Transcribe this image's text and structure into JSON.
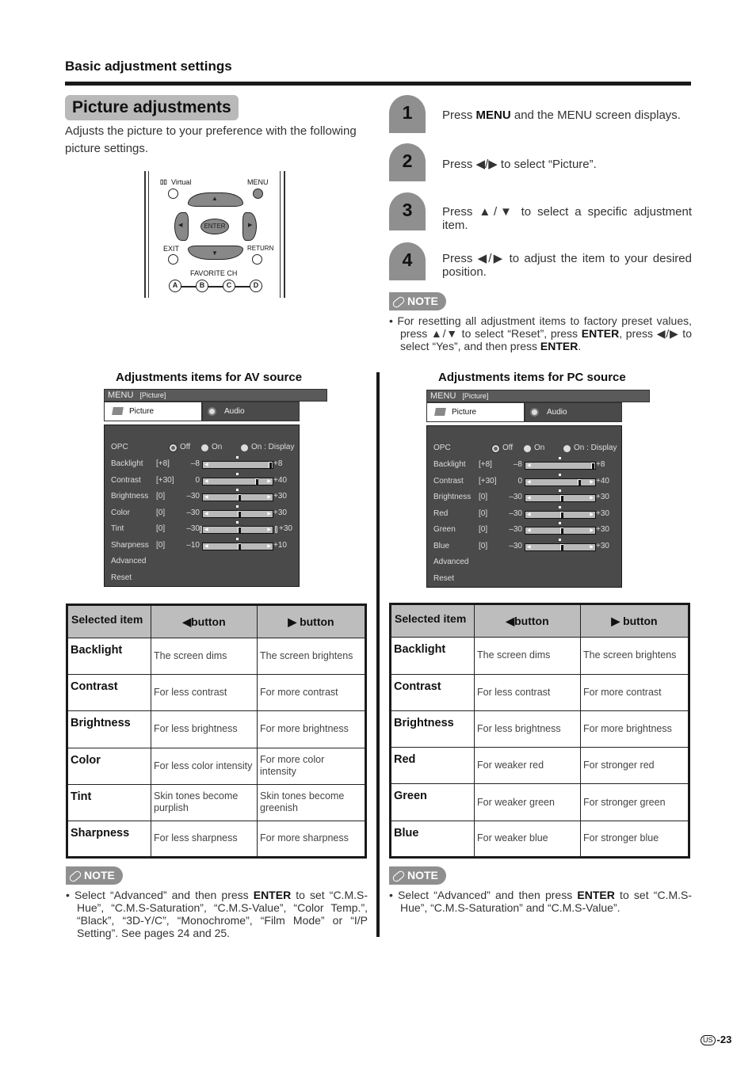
{
  "header": {
    "section_title": "Basic adjustment settings"
  },
  "intro": {
    "title": "Picture adjustments",
    "description": "Adjusts the picture to your preference with the following picture settings."
  },
  "remote": {
    "virtual_label": "Virtual",
    "menu_label": "MENU",
    "enter_label": "ENTER",
    "exit_label": "EXIT",
    "return_label": "RETURN",
    "favorite_label": "FAVORITE CH",
    "favorite_buttons": [
      "A",
      "B",
      "C",
      "D"
    ],
    "up_arrow": "▲",
    "down_arrow": "▼",
    "left_arrow": "◀",
    "right_arrow": "▶"
  },
  "steps": [
    {
      "number": "1",
      "pre": "Press ",
      "bold": "MENU",
      "post": " and the MENU screen displays."
    },
    {
      "number": "2",
      "pre": "Press ◀/▶ to select “Picture”.",
      "bold": "",
      "post": ""
    },
    {
      "number": "3",
      "pre": "Press ▲/▼ to select a specific adjustment item.",
      "bold": "",
      "post": ""
    },
    {
      "number": "4",
      "pre": "Press ◀/▶ to adjust the item to your desired position.",
      "bold": "",
      "post": ""
    }
  ],
  "note_top": {
    "label": "NOTE",
    "parts": [
      "• For resetting all adjustment items to factory preset values, press ▲/▼ to select “Reset”, press ",
      "ENTER",
      ", press ◀/▶ to select “Yes”, and then press ",
      "ENTER",
      "."
    ]
  },
  "av": {
    "title": "Adjustments items for AV source",
    "menu": {
      "menubar": "MENU",
      "menubar_sub": "[Picture]",
      "tab_active": "Picture",
      "tab_inactive": "Audio",
      "opc": {
        "label": "OPC",
        "options": [
          "Off",
          "On",
          "On : Display"
        ],
        "selected": "Off"
      },
      "sliders": [
        {
          "name": "Backlight",
          "current": "[+8]",
          "min": "–8",
          "max": "+8",
          "value": 8,
          "range": [
            -8,
            8
          ]
        },
        {
          "name": "Contrast",
          "current": "[+30]",
          "min": "0",
          "max": "+40",
          "value": 30,
          "range": [
            0,
            40
          ]
        },
        {
          "name": "Brightness",
          "current": "[0]",
          "min": "–30",
          "max": "+30",
          "value": 0,
          "range": [
            -30,
            30
          ]
        },
        {
          "name": "Color",
          "current": "[0]",
          "min": "–30",
          "max": "+30",
          "value": 0,
          "range": [
            -30,
            30
          ]
        },
        {
          "name": "Tint",
          "current": "[0]",
          "min": "–30",
          "max": "+30",
          "value": 0,
          "range": [
            -30,
            30
          ]
        },
        {
          "name": "Sharpness",
          "current": "[0]",
          "min": "–10",
          "max": "+10",
          "value": 0,
          "range": [
            -10,
            10
          ]
        }
      ],
      "extra_items": [
        "Advanced",
        "Reset"
      ]
    },
    "table": {
      "headers": [
        "Selected item",
        "◀button",
        "▶ button"
      ],
      "rows": [
        [
          "Backlight",
          "The screen dims",
          "The screen brightens"
        ],
        [
          "Contrast",
          "For less contrast",
          "For more contrast"
        ],
        [
          "Brightness",
          "For less brightness",
          "For more brightness"
        ],
        [
          "Color",
          "For less color intensity",
          "For more color intensity"
        ],
        [
          "Tint",
          "Skin tones become purplish",
          "Skin tones become greenish"
        ],
        [
          "Sharpness",
          "For less sharpness",
          "For more sharpness"
        ]
      ]
    },
    "note": {
      "label": "NOTE",
      "parts": [
        "• Select “Advanced” and then press ",
        "ENTER",
        " to set “C.M.S-Hue”, “C.M.S-Saturation”, “C.M.S-Value”, “Color Temp.”, “Black”, “3D-Y/C”, “Monochrome”, “Film Mode” or “I/P Setting”. See pages 24 and 25."
      ]
    }
  },
  "pc": {
    "title": "Adjustments items for PC source",
    "menu": {
      "menubar": "MENU",
      "menubar_sub": "[Picture]",
      "tab_active": "Picture",
      "tab_inactive": "Audio",
      "opc": {
        "label": "OPC",
        "options": [
          "Off",
          "On",
          "On : Display"
        ],
        "selected": "Off"
      },
      "sliders": [
        {
          "name": "Backlight",
          "current": "[+8]",
          "min": "–8",
          "max": "+8",
          "value": 8,
          "range": [
            -8,
            8
          ]
        },
        {
          "name": "Contrast",
          "current": "[+30]",
          "min": "0",
          "max": "+40",
          "value": 30,
          "range": [
            0,
            40
          ]
        },
        {
          "name": "Brightness",
          "current": "[0]",
          "min": "–30",
          "max": "+30",
          "value": 0,
          "range": [
            -30,
            30
          ]
        },
        {
          "name": "Red",
          "current": "[0]",
          "min": "–30",
          "max": "+30",
          "value": 0,
          "range": [
            -30,
            30
          ]
        },
        {
          "name": "Green",
          "current": "[0]",
          "min": "–30",
          "max": "+30",
          "value": 0,
          "range": [
            -30,
            30
          ]
        },
        {
          "name": "Blue",
          "current": "[0]",
          "min": "–30",
          "max": "+30",
          "value": 0,
          "range": [
            -30,
            30
          ]
        }
      ],
      "extra_items": [
        "Advanced",
        "Reset"
      ]
    },
    "table": {
      "headers": [
        "Selected item",
        "◀button",
        "▶ button"
      ],
      "rows": [
        [
          "Backlight",
          "The screen dims",
          "The screen brightens"
        ],
        [
          "Contrast",
          "For less contrast",
          "For more contrast"
        ],
        [
          "Brightness",
          "For less brightness",
          "For more brightness"
        ],
        [
          "Red",
          "For weaker red",
          "For stronger red"
        ],
        [
          "Green",
          "For weaker green",
          "For stronger green"
        ],
        [
          "Blue",
          "For weaker blue",
          "For stronger blue"
        ]
      ]
    },
    "note": {
      "label": "NOTE",
      "parts": [
        "• Select “Advanced” and then press ",
        "ENTER",
        " to set “C.M.S-Hue”, “C.M.S-Saturation” and “C.M.S-Value”."
      ]
    }
  },
  "footer": {
    "region_badge": "US",
    "page_number": "-23"
  }
}
